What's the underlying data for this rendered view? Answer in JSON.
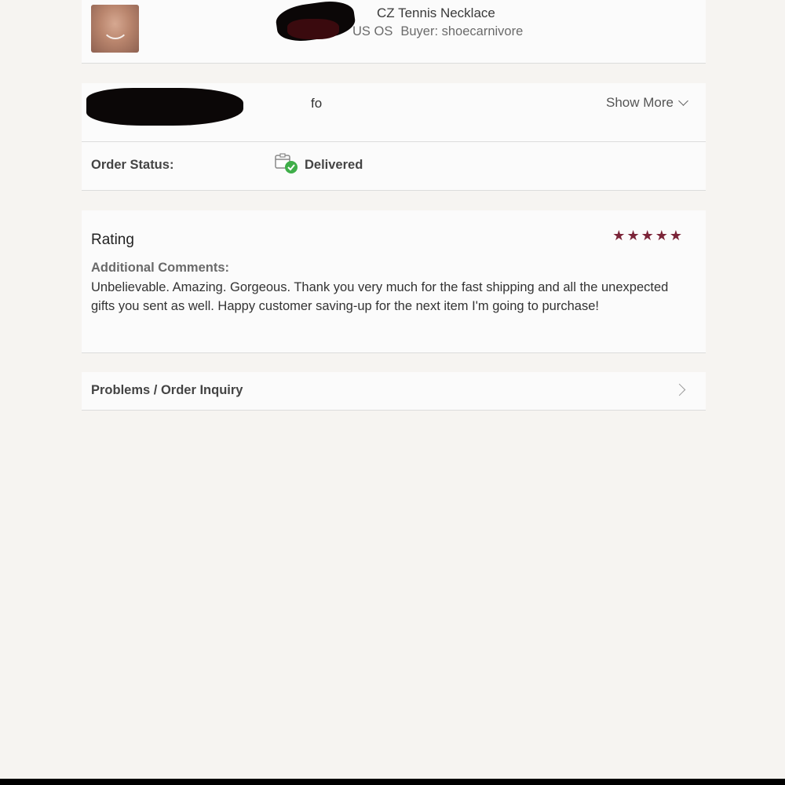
{
  "item": {
    "title": "CZ Tennis Necklace",
    "size": "US OS",
    "buyer": "Buyer: shoecarnivore"
  },
  "info": {
    "heading_partial": "fo",
    "show_more": "Show More"
  },
  "order_status": {
    "label": "Order Status:",
    "value": "Delivered"
  },
  "rating": {
    "title": "Rating",
    "stars": 5,
    "comments_label": "Additional Comments:",
    "comments": "Unbelievable. Amazing. Gorgeous. Thank you very much for the fast shipping and all the unexpected gifts you sent as well. Happy customer saving-up for the next item I'm going to purchase!"
  },
  "problems": {
    "label": "Problems / Order Inquiry"
  },
  "colors": {
    "star": "#7b2438",
    "delivered_check": "#3fae49"
  }
}
